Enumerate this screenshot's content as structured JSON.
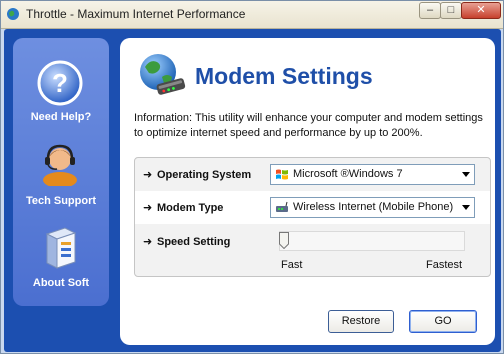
{
  "window": {
    "title": "Throttle - Maximum Internet Performance"
  },
  "sidebar": {
    "items": [
      {
        "label": "Need Help?",
        "icon": "help-question-icon"
      },
      {
        "label": "Tech Support",
        "icon": "support-agent-icon"
      },
      {
        "label": "About Soft",
        "icon": "software-box-icon"
      }
    ]
  },
  "main": {
    "heading": "Modem Settings",
    "info": "Information: This utility will enhance your computer and modem settings to optimize internet speed and performance by up to 200%.",
    "settings": {
      "os": {
        "label": "Operating System",
        "value": "Microsoft ®Windows 7",
        "icon": "windows-logo-icon"
      },
      "modem": {
        "label": "Modem Type",
        "value": "Wireless Internet (Mobile Phone)",
        "icon": "modem-icon"
      },
      "speed": {
        "label": "Speed Setting",
        "min_label": "Fast",
        "max_label": "Fastest",
        "value_fraction": 0.0
      }
    },
    "buttons": {
      "restore": "Restore",
      "go": "GO"
    }
  },
  "colors": {
    "frame": "#1c4fb0",
    "heading": "#1f4fa8",
    "sidebar": "#5a7ed8"
  }
}
